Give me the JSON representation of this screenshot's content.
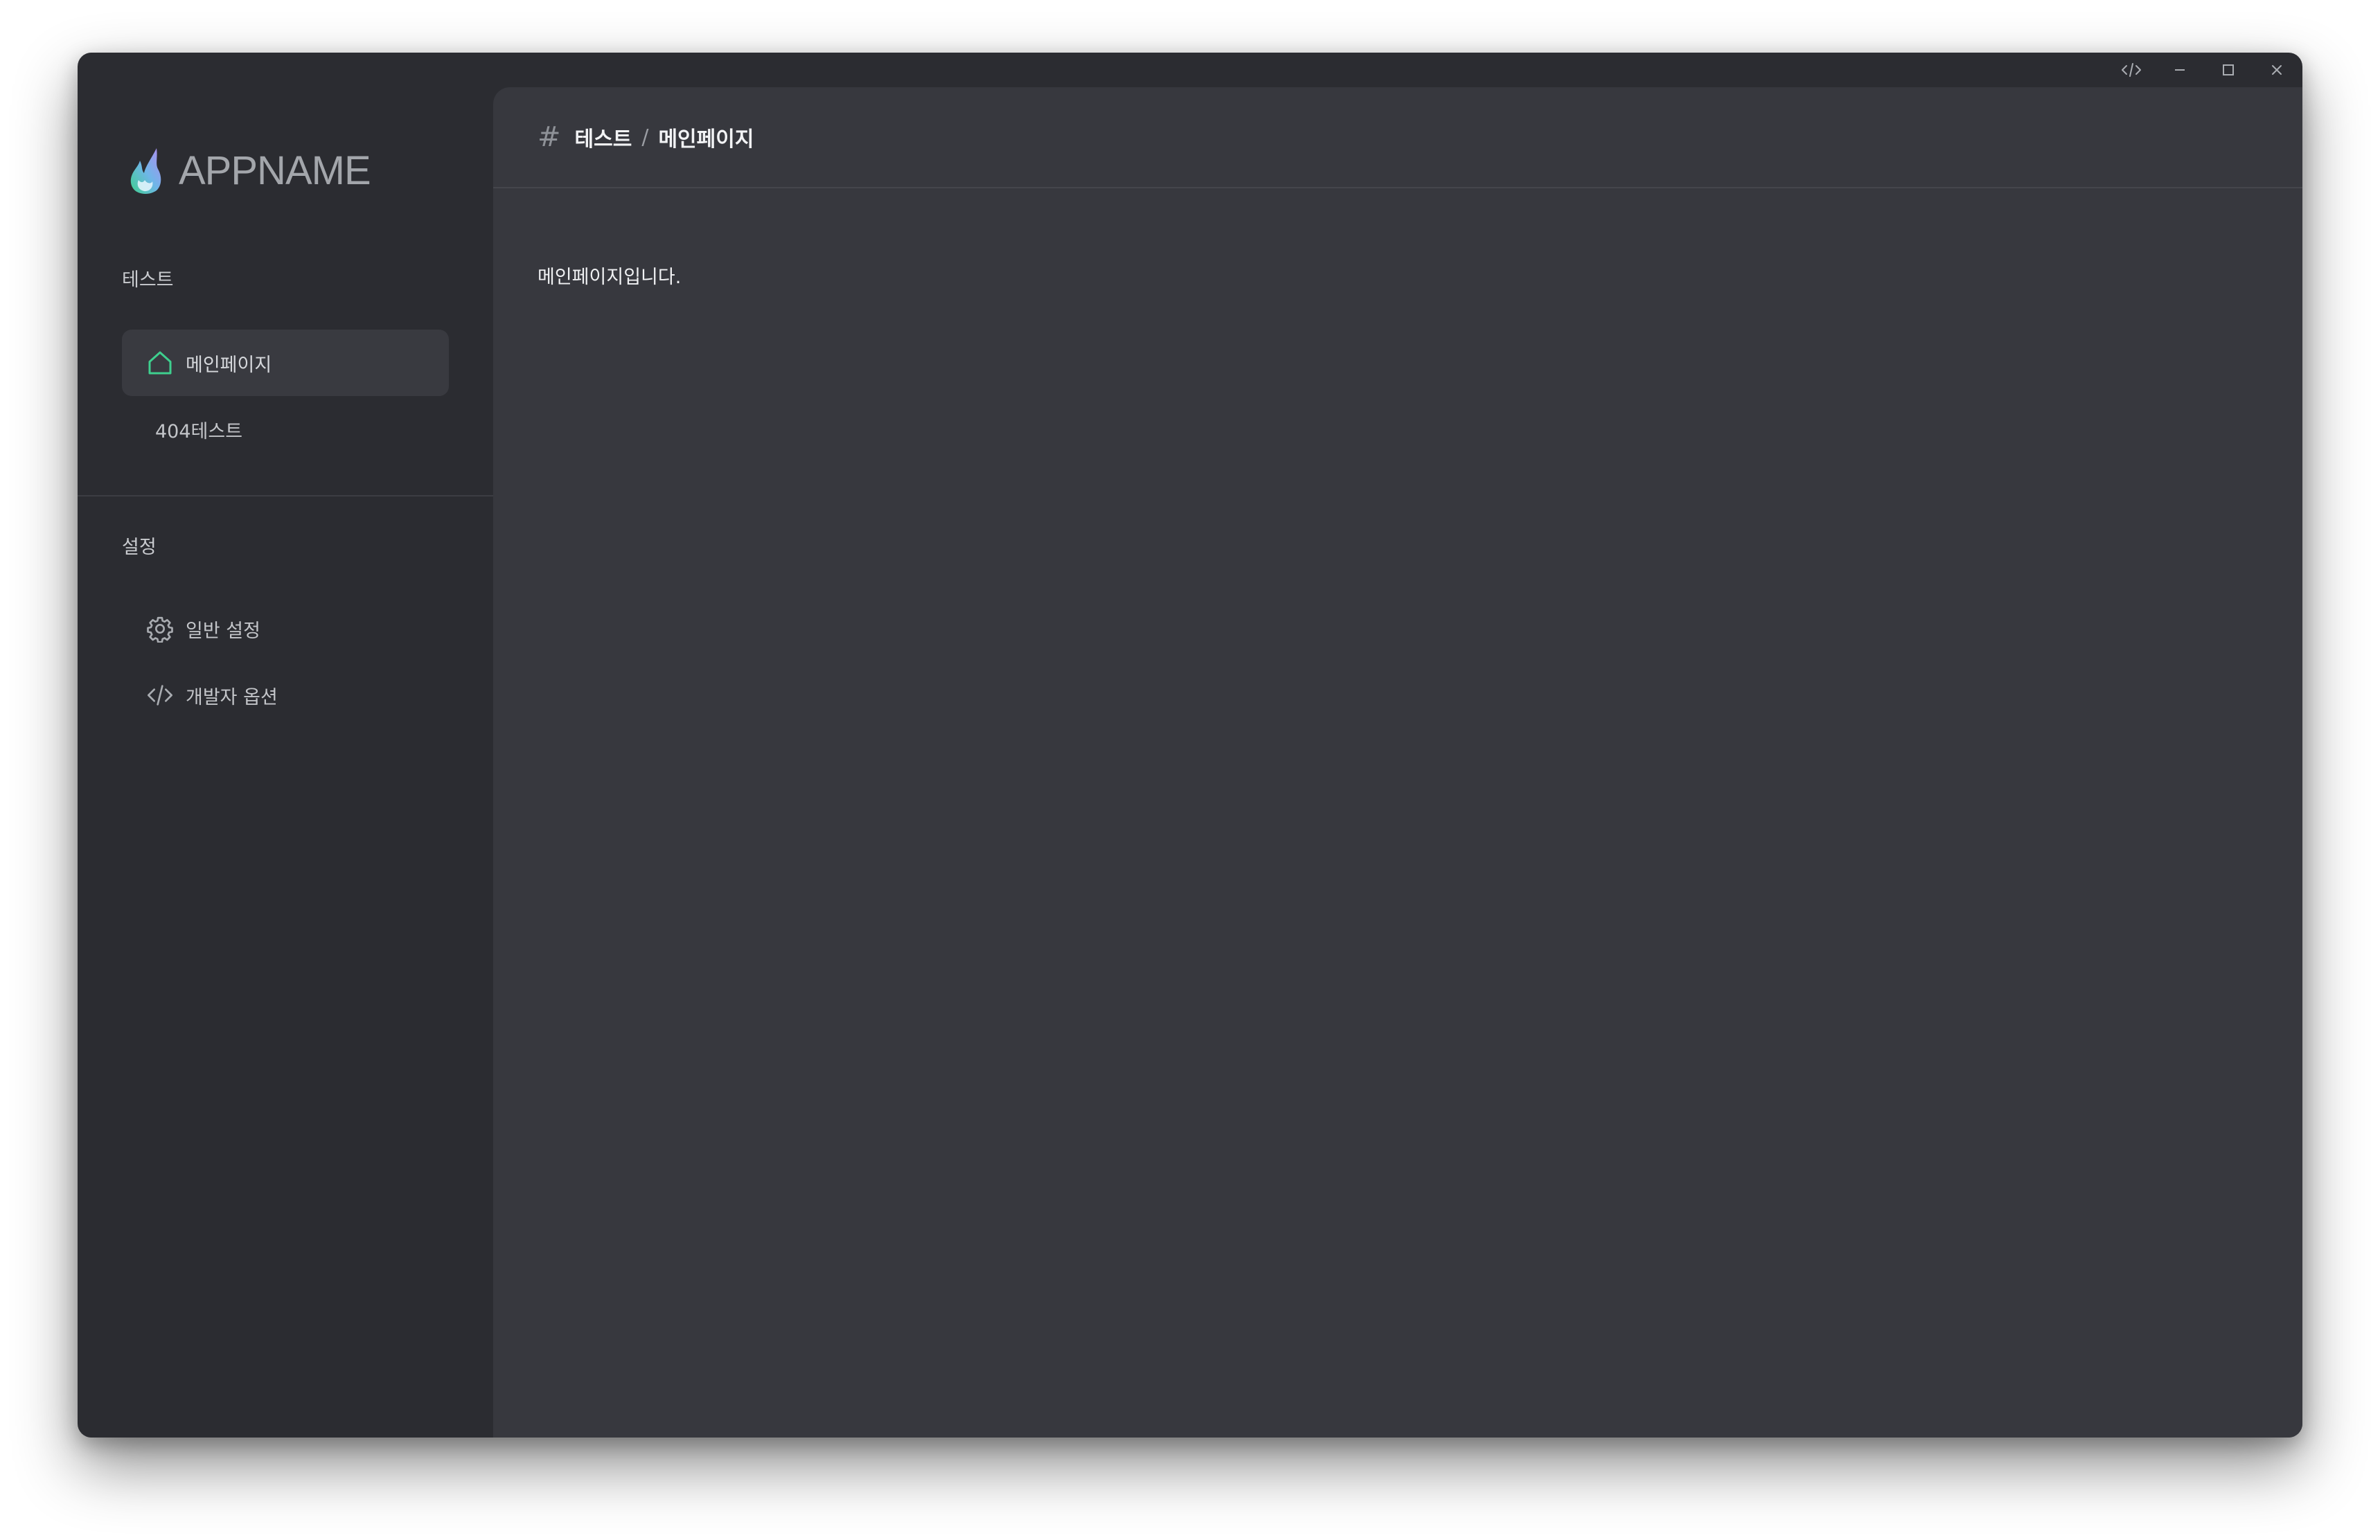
{
  "app": {
    "name": "APPNAME"
  },
  "window_controls": [
    {
      "name": "devtools",
      "icon": "code-icon"
    },
    {
      "name": "minimize",
      "icon": "minimize-icon"
    },
    {
      "name": "maximize",
      "icon": "maximize-icon"
    },
    {
      "name": "close",
      "icon": "close-icon"
    }
  ],
  "sidebar": {
    "sections": [
      {
        "title": "테스트",
        "items": [
          {
            "label": "메인페이지",
            "icon": "home-icon",
            "active": true
          },
          {
            "label": "404테스트",
            "icon": null,
            "active": false
          }
        ]
      },
      {
        "title": "설정",
        "items": [
          {
            "label": "일반 설정",
            "icon": "gear-icon",
            "active": false
          },
          {
            "label": "개발자 옵션",
            "icon": "code-icon",
            "active": false
          }
        ]
      }
    ]
  },
  "header": {
    "icon": "hash-icon",
    "hash": "#",
    "breadcrumb": [
      "테스트",
      "메인페이지"
    ],
    "separator": "/"
  },
  "content": {
    "text": "메인페이지입니다."
  },
  "colors": {
    "accent": "#3ecf8e",
    "sidebar_bg": "#2b2c31",
    "main_bg": "#37383e"
  }
}
